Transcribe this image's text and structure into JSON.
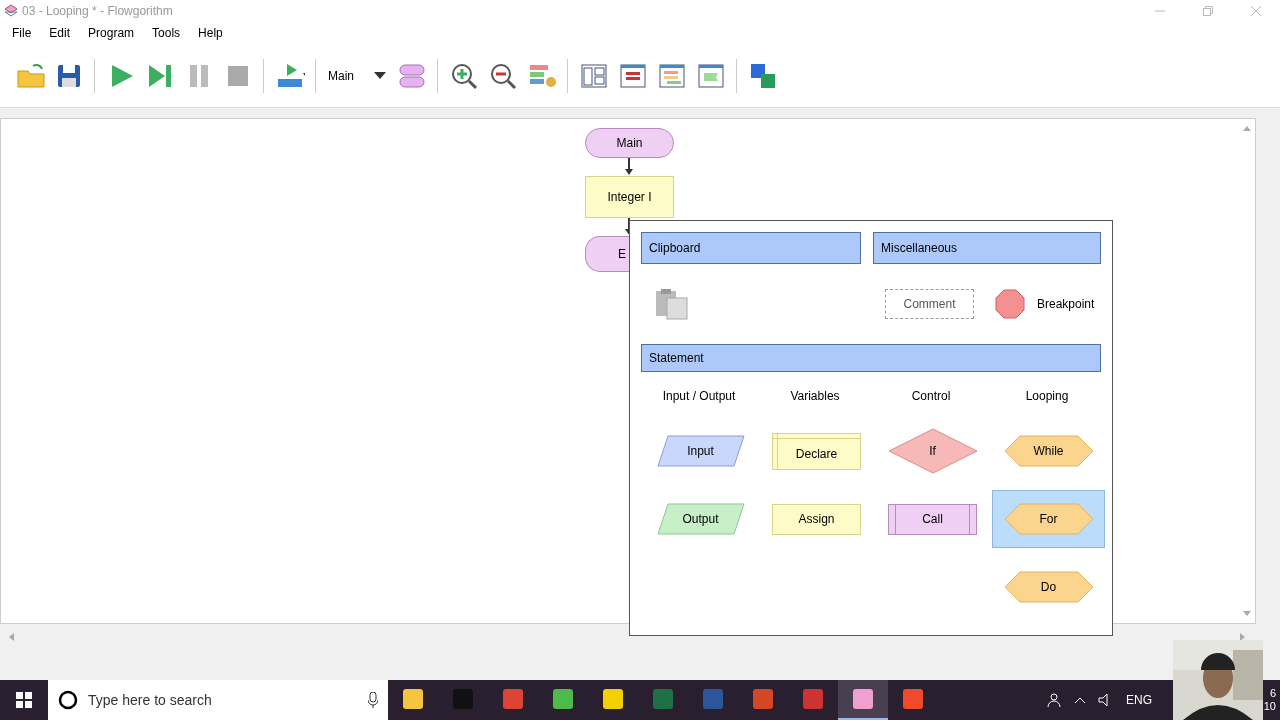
{
  "window": {
    "title": "03 - Looping * - Flowgorithm"
  },
  "menu": [
    "File",
    "Edit",
    "Program",
    "Tools",
    "Help"
  ],
  "toolbar": {
    "function_select": "Main"
  },
  "flowchart": [
    {
      "kind": "terminal",
      "label": "Main"
    },
    {
      "kind": "declare",
      "label": "Integer I"
    },
    {
      "kind": "terminal",
      "label": "E"
    }
  ],
  "palette": {
    "clipboard": {
      "title": "Clipboard"
    },
    "miscellaneous": {
      "title": "Miscellaneous",
      "items": [
        {
          "kind": "comment",
          "label": "Comment"
        },
        {
          "kind": "breakpoint",
          "label": "Breakpoint"
        }
      ]
    },
    "statement": {
      "title": "Statement",
      "columns": [
        {
          "title": "Input / Output",
          "items": [
            {
              "kind": "input",
              "label": "Input",
              "selected": false
            },
            {
              "kind": "output",
              "label": "Output",
              "selected": false
            }
          ]
        },
        {
          "title": "Variables",
          "items": [
            {
              "kind": "declare",
              "label": "Declare",
              "selected": false
            },
            {
              "kind": "assign",
              "label": "Assign",
              "selected": false
            }
          ]
        },
        {
          "title": "Control",
          "items": [
            {
              "kind": "if",
              "label": "If",
              "selected": false
            },
            {
              "kind": "call",
              "label": "Call",
              "selected": false
            }
          ]
        },
        {
          "title": "Looping",
          "items": [
            {
              "kind": "loop",
              "label": "While",
              "selected": false
            },
            {
              "kind": "loop",
              "label": "For",
              "selected": true
            },
            {
              "kind": "loop",
              "label": "Do",
              "selected": false
            }
          ]
        }
      ]
    }
  },
  "taskbar": {
    "search_placeholder": "Type here to search",
    "apps": [
      {
        "kind": "folder",
        "selected": false
      },
      {
        "kind": "terminal",
        "selected": false
      },
      {
        "kind": "chrome",
        "selected": false
      },
      {
        "kind": "green",
        "selected": false
      },
      {
        "kind": "notes",
        "selected": false
      },
      {
        "kind": "excel",
        "selected": false
      },
      {
        "kind": "word",
        "selected": false
      },
      {
        "kind": "powerpoint",
        "selected": false
      },
      {
        "kind": "blocks",
        "selected": false
      },
      {
        "kind": "flowgorithm",
        "selected": true
      },
      {
        "kind": "orange",
        "selected": false
      }
    ],
    "language": "ENG",
    "clock": [
      "6",
      "10"
    ]
  }
}
